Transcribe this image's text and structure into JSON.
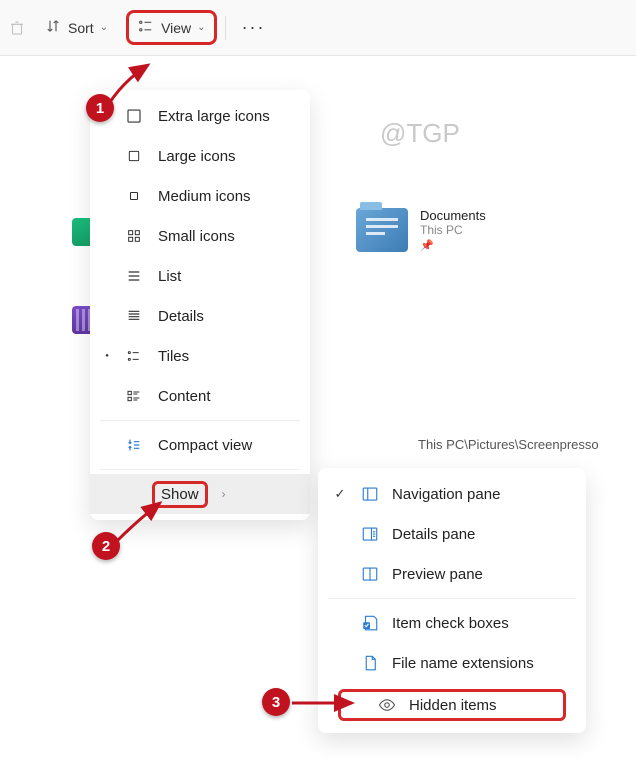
{
  "toolbar": {
    "sort_label": "Sort",
    "view_label": "View"
  },
  "watermark": "@TGP",
  "folder": {
    "name": "Documents",
    "location": "This PC"
  },
  "breadcrumb": "This PC\\Pictures\\Screenpresso",
  "view_menu": {
    "items": [
      {
        "label": "Extra large icons",
        "selected": false
      },
      {
        "label": "Large icons",
        "selected": false
      },
      {
        "label": "Medium icons",
        "selected": false
      },
      {
        "label": "Small icons",
        "selected": false
      },
      {
        "label": "List",
        "selected": false
      },
      {
        "label": "Details",
        "selected": false
      },
      {
        "label": "Tiles",
        "selected": true
      },
      {
        "label": "Content",
        "selected": false
      }
    ],
    "compact_label": "Compact view",
    "show_label": "Show"
  },
  "show_menu": {
    "items": [
      {
        "label": "Navigation pane",
        "checked": true
      },
      {
        "label": "Details pane",
        "checked": false
      },
      {
        "label": "Preview pane",
        "checked": false
      },
      {
        "label": "Item check boxes",
        "checked": false
      },
      {
        "label": "File name extensions",
        "checked": false
      },
      {
        "label": "Hidden items",
        "checked": false
      }
    ]
  },
  "callouts": {
    "one": "1",
    "two": "2",
    "three": "3"
  }
}
